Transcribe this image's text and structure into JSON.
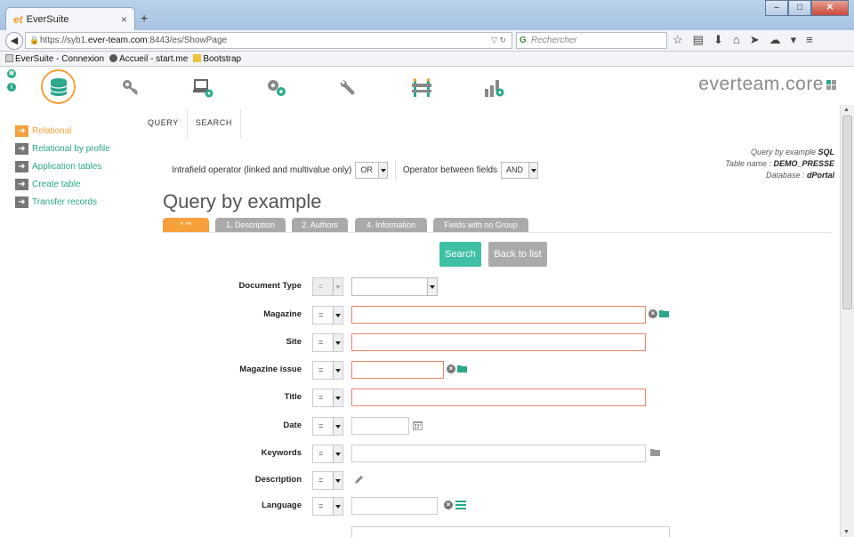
{
  "browser": {
    "tab_logo": "et",
    "tab_title": "EverSuite",
    "tab_close": "×",
    "new_tab": "+",
    "win_min": "–",
    "win_max": "□",
    "win_close": "✕",
    "url_prefix": "https://syb1.",
    "url_host": "ever-team.com",
    "url_rest": ":8443/es/ShowPage",
    "search_placeholder": "Rechercher",
    "bookmarks": [
      {
        "label": "EverSuite - Connexion"
      },
      {
        "label": "Accueil - start.me"
      },
      {
        "label": "Bootstrap"
      }
    ]
  },
  "app": {
    "brand": "everteam.core",
    "top_icons": [
      "database-icon",
      "key-icon",
      "computer-settings-icon",
      "gears-icon",
      "wrench-icon",
      "barrier-icon",
      "chart-settings-icon"
    ],
    "sidebar": [
      {
        "label": "Relational",
        "active": true
      },
      {
        "label": "Relational by profile"
      },
      {
        "label": "Application tables"
      },
      {
        "label": "Create table"
      },
      {
        "label": "Transfer records"
      }
    ],
    "tabs": [
      {
        "label": "QUERY"
      },
      {
        "label": "SEARCH"
      }
    ],
    "options": {
      "intrafield_label": "Intrafield operator (linked and multivalue only)",
      "intrafield_value": "OR",
      "between_label": "Operator between fields",
      "between_value": "AND"
    },
    "query_info": {
      "line1_prefix": "Query by example ",
      "line1_bold": "SQL",
      "line2_prefix": "Table name : ",
      "line2_bold": "DEMO_PRESSE",
      "line3_prefix": "Database : ",
      "line3_bold": "dPortal"
    },
    "page_title": "Query by example",
    "subtabs": [
      {
        "label": "* **",
        "active": true
      },
      {
        "label": "1. Description"
      },
      {
        "label": "2. Authors"
      },
      {
        "label": "4. Information"
      },
      {
        "label": "Fields with no Group"
      }
    ],
    "buttons": {
      "search": "Search",
      "back": "Back to list"
    },
    "fields": [
      {
        "label": "Document Type",
        "op": "="
      },
      {
        "label": "Magazine",
        "op": "="
      },
      {
        "label": "Site",
        "op": "="
      },
      {
        "label": "Magazine issue",
        "op": "="
      },
      {
        "label": "Title",
        "op": "="
      },
      {
        "label": "Date",
        "op": "="
      },
      {
        "label": "Keywords",
        "op": "="
      },
      {
        "label": "Description",
        "op": "="
      },
      {
        "label": "Language",
        "op": "="
      }
    ],
    "colors": {
      "accent": "#f6a03c",
      "teal": "#2aa789",
      "button": "#3dc0a3",
      "required_border": "#e8836b"
    }
  }
}
